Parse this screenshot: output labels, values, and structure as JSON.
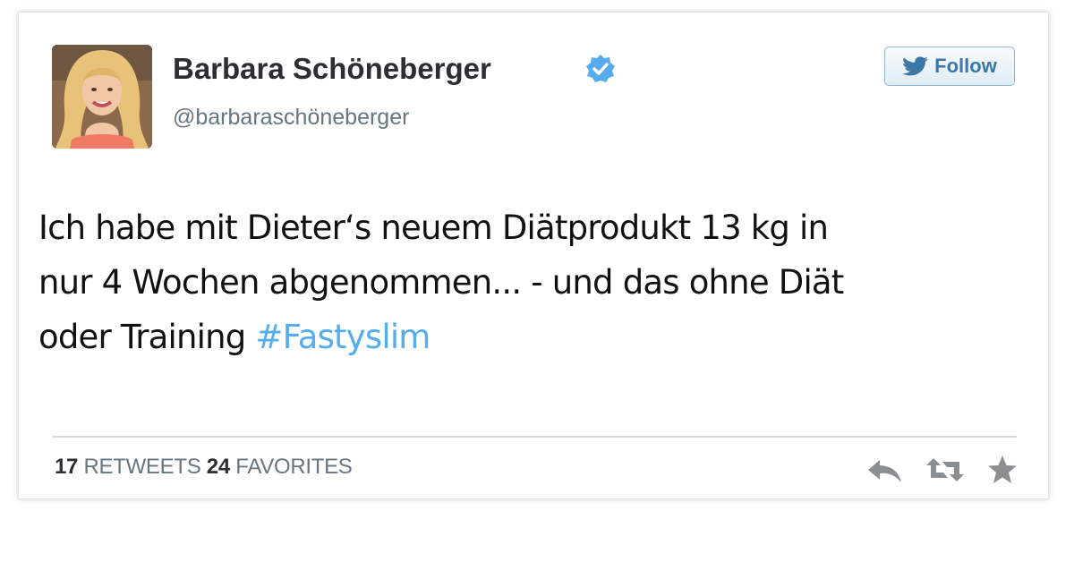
{
  "user": {
    "display_name": "Barbara Schöneberger",
    "handle": "@barbaraschöneberger",
    "avatar_icon": "profile-photo",
    "verified_icon": "verified-badge-icon"
  },
  "follow_button": {
    "label": "Follow",
    "icon": "twitter-bird-icon"
  },
  "tweet": {
    "lines": [
      "Ich habe mit Dieter‘s neuem Diätprodukt 13 kg in",
      "nur 4 Wochen abgenommen... - und das ohne Diät",
      "oder Training "
    ],
    "hashtag": "#Fastyslim"
  },
  "stats": {
    "retweets_count": "17",
    "retweets_label": "RETWEETS",
    "favorites_count": "24",
    "favorites_label": "FAVORITES"
  },
  "actions": [
    "reply-icon",
    "retweet-icon",
    "favorite-icon"
  ],
  "colors": {
    "hashtag": "#55acee",
    "verified": "#55acee",
    "follow_text": "#3d77a7",
    "action_icons": "#8a8f94"
  }
}
